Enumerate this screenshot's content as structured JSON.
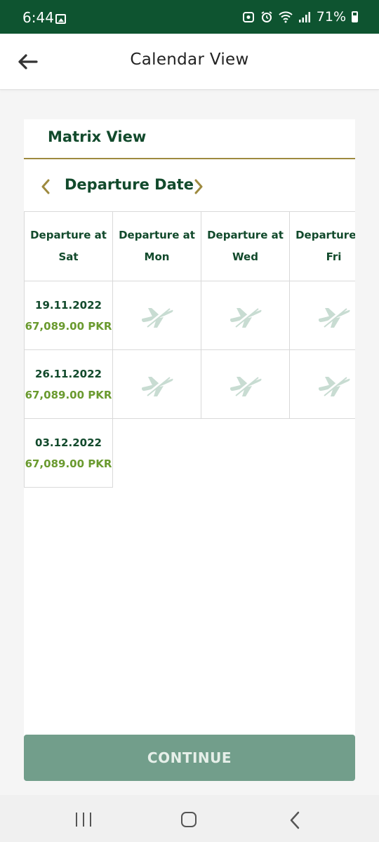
{
  "status_bar": {
    "time": "6:44",
    "battery": "71%"
  },
  "app_bar": {
    "title": "Calendar View"
  },
  "matrix": {
    "title": "Matrix View",
    "date_nav_label": "Departure Date",
    "columns": [
      [
        "Departure at",
        "Sat"
      ],
      [
        "Departure at",
        "Mon"
      ],
      [
        "Departure at",
        "Wed"
      ],
      [
        "Departure at",
        "Fri"
      ]
    ],
    "rows": [
      {
        "date": "19.11.2022",
        "price": "67,089.00 PKR"
      },
      {
        "date": "26.11.2022",
        "price": "67,089.00 PKR"
      },
      {
        "date": "03.12.2022",
        "price": "67,089.00 PKR"
      }
    ]
  },
  "continue_label": "CONTINUE",
  "colors": {
    "brand_green": "#0e5430",
    "title_green": "#124a2c",
    "price_green": "#6a9a2f",
    "gold": "#9e8a3f",
    "button": "#729e8b"
  }
}
